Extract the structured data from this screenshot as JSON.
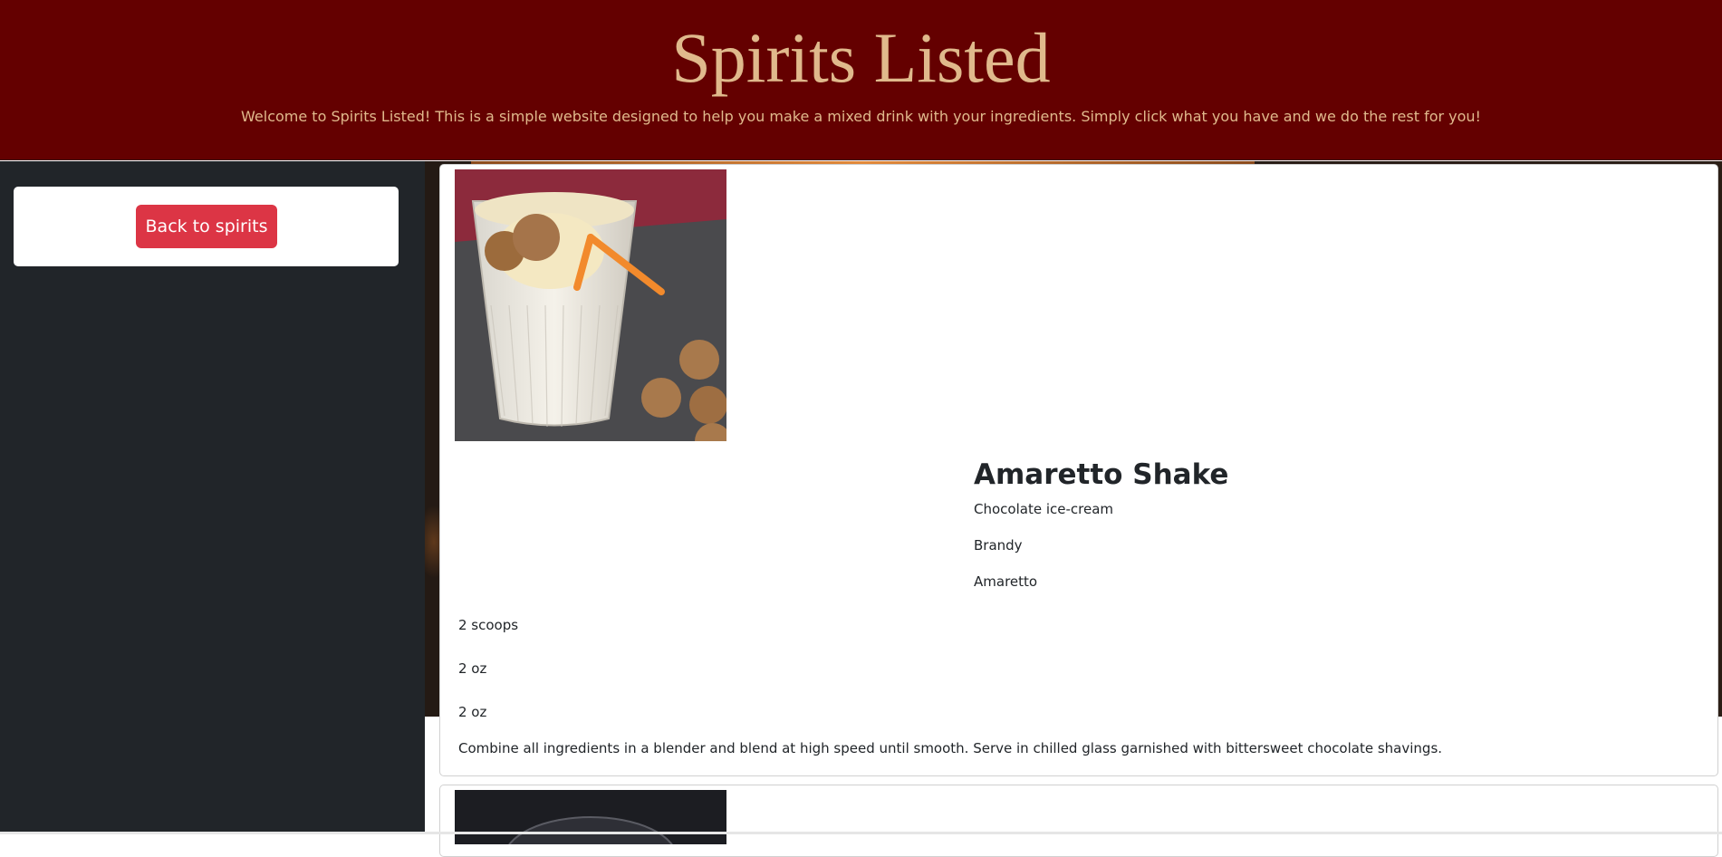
{
  "header": {
    "title": "Spirits Listed",
    "subtitle": "Welcome to Spirits Listed! This is a simple website designed to help you make a mixed drink with your ingredients. Simply click what you have and we do the rest for you!"
  },
  "sidebar": {
    "back_label": "Back to spirits"
  },
  "recipes": [
    {
      "name": "Amaretto Shake",
      "image_icon": "amaretto-shake-photo",
      "ingredients": [
        "Chocolate ice-cream",
        "Brandy",
        "Amaretto"
      ],
      "measures": [
        "2 scoops",
        "2 oz",
        "2 oz"
      ],
      "instructions": "Combine all ingredients in a blender and blend at high speed until smooth. Serve in chilled glass garnished with bittersweet chocolate shavings."
    },
    {
      "image_icon": "dark-drink-photo"
    }
  ],
  "colors": {
    "header_bg": "#640000",
    "header_text": "#e0b98c",
    "sidebar_bg": "#212529",
    "button_bg": "#dc3545"
  }
}
